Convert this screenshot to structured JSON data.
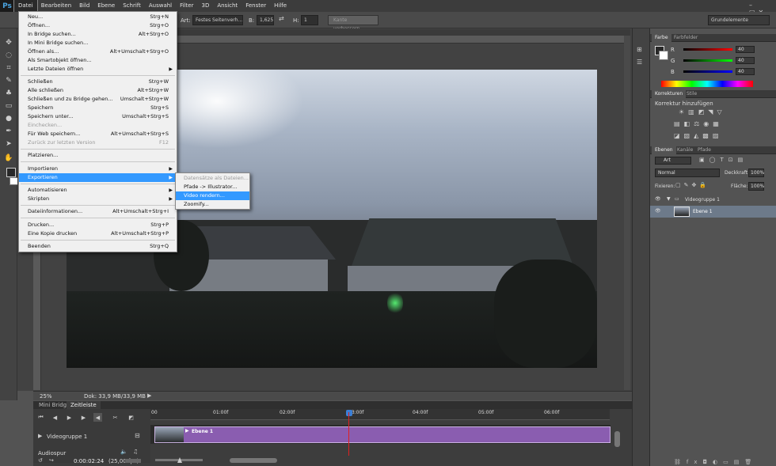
{
  "app": {
    "logo": "Ps"
  },
  "menubar": [
    "Datei",
    "Bearbeiten",
    "Bild",
    "Ebene",
    "Schrift",
    "Auswahl",
    "Filter",
    "3D",
    "Ansicht",
    "Fenster",
    "Hilfe"
  ],
  "options": {
    "art_label": "Art:",
    "art_value": "Festes Seitenverh...",
    "b_label": "B:",
    "b_value": "1,625",
    "h_label": "H:",
    "h_value": "1",
    "refine_btn": "Kante verbessern...",
    "workspace": "Grundelemente"
  },
  "file_menu": [
    {
      "label": "Neu...",
      "shortcut": "Strg+N"
    },
    {
      "label": "Öffnen...",
      "shortcut": "Strg+O"
    },
    {
      "label": "In Bridge suchen...",
      "shortcut": "Alt+Strg+O"
    },
    {
      "label": "In Mini Bridge suchen...",
      "shortcut": ""
    },
    {
      "label": "Öffnen als...",
      "shortcut": "Alt+Umschalt+Strg+O"
    },
    {
      "label": "Als Smartobjekt öffnen...",
      "shortcut": ""
    },
    {
      "label": "Letzte Dateien öffnen",
      "shortcut": ""
    },
    {
      "label": "Schließen",
      "shortcut": "Strg+W"
    },
    {
      "label": "Alle schließen",
      "shortcut": "Alt+Strg+W"
    },
    {
      "label": "Schließen und zu Bridge gehen...",
      "shortcut": "Umschalt+Strg+W"
    },
    {
      "label": "Speichern",
      "shortcut": "Strg+S"
    },
    {
      "label": "Speichern unter...",
      "shortcut": "Umschalt+Strg+S"
    },
    {
      "label": "Einchecken...",
      "shortcut": ""
    },
    {
      "label": "Für Web speichern...",
      "shortcut": "Alt+Umschalt+Strg+S"
    },
    {
      "label": "Zurück zur letzten Version",
      "shortcut": "F12"
    },
    {
      "label": "Platzieren...",
      "shortcut": ""
    },
    {
      "label": "Importieren",
      "shortcut": ""
    },
    {
      "label": "Exportieren",
      "shortcut": ""
    },
    {
      "label": "Automatisieren",
      "shortcut": ""
    },
    {
      "label": "Skripten",
      "shortcut": ""
    },
    {
      "label": "Dateiinformationen...",
      "shortcut": "Alt+Umschalt+Strg+I"
    },
    {
      "label": "Drucken...",
      "shortcut": "Strg+P"
    },
    {
      "label": "Eine Kopie drucken",
      "shortcut": "Alt+Umschalt+Strg+P"
    },
    {
      "label": "Beenden",
      "shortcut": "Strg+Q"
    }
  ],
  "export_submenu": [
    "Datensätze als Dateien...",
    "Pfade -> Illustrator...",
    "Video rendern...",
    "Zoomify..."
  ],
  "status": {
    "zoom": "25%",
    "doc": "Dok: 33,9 MB/33,9 MB"
  },
  "timeline": {
    "tabs": [
      "Mini Bridge",
      "Zeitleiste"
    ],
    "times": [
      "00",
      "01:00f",
      "02:00f",
      "03:00f",
      "04:00f",
      "05:00f",
      "06:00f"
    ],
    "group_label": "Videogruppe 1",
    "clip_label": "Ebene 1",
    "audio_label": "Audiospur",
    "timecode": "0:00:02:24",
    "fps": "(25,00 fps)"
  },
  "color_panel": {
    "tabs": [
      "Farbe",
      "Farbfelder"
    ],
    "r_label": "R",
    "g_label": "G",
    "b_label": "B",
    "r": "40",
    "g": "40",
    "b": "40"
  },
  "adjust_panel": {
    "tabs": [
      "Korrekturen",
      "Stile"
    ],
    "title": "Korrektur hinzufügen"
  },
  "layers_panel": {
    "tabs": [
      "Ebenen",
      "Kanäle",
      "Pfade"
    ],
    "filter": "Art",
    "blend": "Normal",
    "opacity_label": "Deckkraft:",
    "opacity": "100%",
    "lock_label": "Fixieren:",
    "fill_label": "Fläche:",
    "fill": "100%",
    "group": "Videogruppe 1",
    "layer": "Ebene 1"
  }
}
